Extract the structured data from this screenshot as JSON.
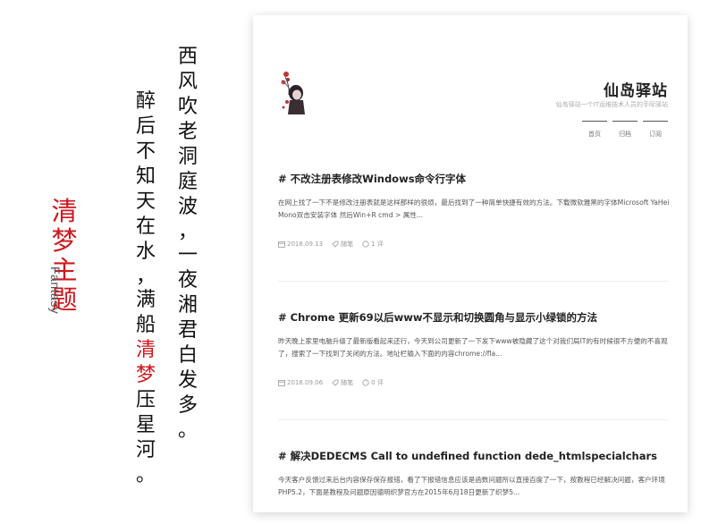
{
  "poster": {
    "theme_chars": [
      "清",
      "梦",
      "主",
      "题"
    ],
    "theme_en": "Fantasy",
    "poem_right_chars": [
      "西",
      "风",
      "吹",
      "老",
      "洞",
      "庭",
      "波",
      "，",
      "一",
      "夜",
      "湘",
      "君",
      "白",
      "发",
      "多",
      "。"
    ],
    "poem_left_chars": [
      "醉",
      "后",
      "不",
      "知",
      "天",
      "在",
      "水",
      "，",
      "满",
      "船",
      "清",
      "梦",
      "压",
      "星",
      "河",
      "。"
    ]
  },
  "blog": {
    "title": "仙岛驿站",
    "subtitle": "仙岛驿站一个IT运维技术人员的手际驿站",
    "nav": [
      "首页",
      "归档",
      "订阅"
    ],
    "posts": [
      {
        "hash": "#",
        "title": "不改注册表修改Windows命令行字体",
        "excerpt": "在网上找了一下不是修改注册表就是这样那样的很烦，最后找到了一种简单快捷有效的方法。下载微软雅黑的字体Microsoft YaHei Mono双击安装字体 然后Win+R cmd > 属性...",
        "date": "2018.09.13",
        "category": "随笔",
        "comments": "1 评"
      },
      {
        "hash": "#",
        "title": "Chrome 更新69以后www不显示和切换圆角与显示小绿锁的方法",
        "excerpt": "昨天晚上家里电脑升级了最新版看起来还行，今天到公司更新了一下发下www被隐藏了这个对我们局IT的有时候很不方便的不喜观了，搜索了一下找到了关闭的方法。地址栏输入下面的内容chrome://fla...",
        "date": "2018.09.06",
        "category": "随笔",
        "comments": "0 评"
      },
      {
        "hash": "#",
        "title": "解决DEDECMS Call to undefined function dede_htmlspecialchars",
        "excerpt": "今天客户反馈过来后台内容保存保存报错，看了下报错信息应该是函数问题所以直接百度了一下，按教程已经解决问题，客户环境PHP5.2，下面是教程及问题原因德明织梦官方在2015年6月18日更新了织梦5..."
      }
    ]
  },
  "colors": {
    "accent_red": "#d0161d",
    "text_dark": "#222222",
    "text_muted": "#9a9a9a"
  }
}
